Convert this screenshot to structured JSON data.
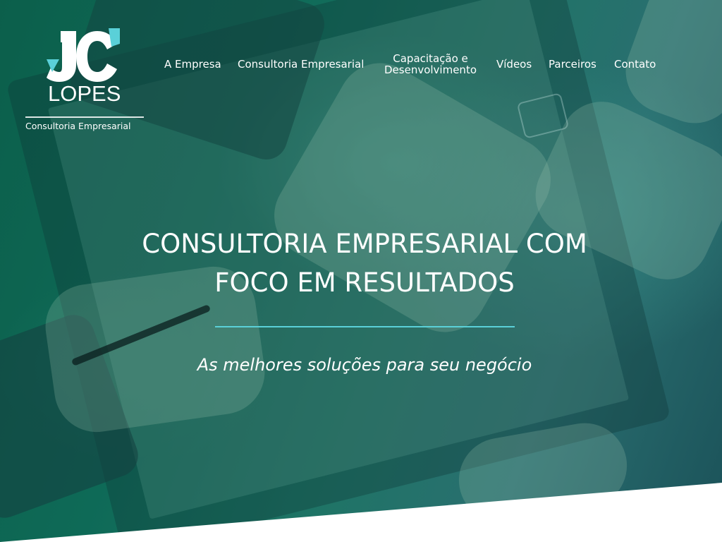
{
  "colors": {
    "accent_line": "#5ad0d8",
    "logo_accent": "#5ad0d8",
    "hero_overlay": "#0e6a57",
    "text": "#ffffff"
  },
  "logo": {
    "mark_text": "JC",
    "name": "LOPES",
    "subtitle": "Consultoria Empresarial"
  },
  "nav": {
    "items": [
      {
        "label": "A Empresa"
      },
      {
        "label": "Consultoria Empresarial"
      },
      {
        "label": "Capacitação e Desenvolvimento",
        "line1": "Capacitação e",
        "line2": "Desenvolvimento"
      },
      {
        "label": "Vídeos"
      },
      {
        "label": "Parceiros"
      },
      {
        "label": "Contato"
      }
    ]
  },
  "hero": {
    "headline_line1": "CONSULTORIA EMPRESARIAL COM",
    "headline_line2": "FOCO EM RESULTADOS",
    "tagline": "As melhores soluções para seu negócio"
  }
}
